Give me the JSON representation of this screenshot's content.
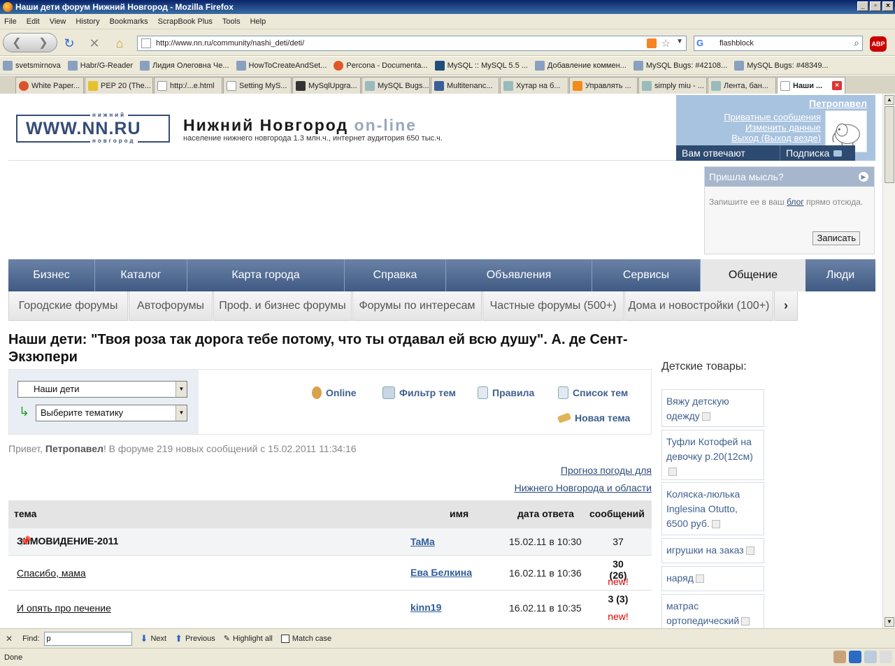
{
  "window": {
    "title": "Наши дети форум Нижний Новгород - Mozilla Firefox",
    "btn_min": "_",
    "btn_max": "▫",
    "btn_close": "×"
  },
  "menu": [
    "File",
    "Edit",
    "View",
    "History",
    "Bookmarks",
    "ScrapBook Plus",
    "Tools",
    "Help"
  ],
  "nav": {
    "url": "http://www.nn.ru/community/nashi_deti/deti/",
    "search_value": "flashblock",
    "abp": "ABP"
  },
  "bookmarks": [
    "svetsmirnova",
    "Habr/G-Reader",
    "Лидия Олеговна Че...",
    "HowToCreateAndSet...",
    "Percona - Documenta...",
    "MySQL :: MySQL 5.5 ...",
    "Добавление коммен...",
    "MySQL Bugs: #42108...",
    "MySQL Bugs: #48349..."
  ],
  "tabs": [
    "White Paper...",
    "PEP 20 (The...",
    "http:/...e.html",
    "Setting MyS...",
    "MySqlUpgra...",
    "MySQL Bugs...",
    "Multitenanc...",
    "Хутар на б...",
    "Управлять ...",
    "simply miu - ...",
    "Лента, бан...",
    "Наши ..."
  ],
  "site": {
    "logo": "WWW.NN.RU",
    "logo_top": "нижний",
    "logo_bottom": "новгород",
    "title": "Нижний Новгород",
    "title_suffix": "on-line",
    "subtitle": "население нижнего новгорода 1.3 млн.ч., интернет аудитория 650 тыс.ч."
  },
  "user": {
    "name": "Петропавел",
    "links": [
      "Приватные сообщения",
      "Изменить данные",
      "Выход (Выход везде)"
    ],
    "bar_left": "Вам отвечают",
    "bar_right": "Подписка"
  },
  "idea": {
    "title": "Пришла мысль?",
    "text_before": "Запишите ее в ваш ",
    "link": "блог",
    "text_after": " прямо отсюда.",
    "button": "Записать"
  },
  "main_nav": [
    {
      "label": "Бизнес"
    },
    {
      "label": "Каталог"
    },
    {
      "label": "Карта города"
    },
    {
      "label": "Справка"
    },
    {
      "label": "Объявления"
    },
    {
      "label": "Сервисы"
    },
    {
      "label": "Общение"
    },
    {
      "label": "Люди"
    }
  ],
  "sub_nav": [
    "Городские форумы",
    "Автофорумы",
    "Проф. и бизнес форумы",
    "Форумы по интересам",
    "Частные форумы (500+)",
    "Дома и новостройки (100+)"
  ],
  "forum": {
    "title": "Наши дети: \"Твоя роза так дорога тебе потому, что ты отдавал ей всю душу\". А. де Сент-Экзюпери",
    "select_forum": "Наши дети",
    "select_theme": "Выберите тематику",
    "tools": [
      "Online",
      "Фильтр тем",
      "Правила",
      "Список тем",
      "Новая тема"
    ],
    "greet_prefix": "Привет, ",
    "greet_user": "Петропавел",
    "greet_suffix": "! В форуме 219 новых сообщений с 15.02.2011 11:34:16",
    "weather_line1": "Прогноз погоды для",
    "weather_line2": "Нижнего Новгорода и области",
    "columns": [
      "тема",
      "имя",
      "дата ответа",
      "сообщений"
    ],
    "rows": [
      {
        "topic": "ЗИМОВИДЕНИЕ-2011",
        "author": "TaMa",
        "date": "15.02.11 в 10:30",
        "count": "37",
        "new": ""
      },
      {
        "topic": "Спасибо, мама",
        "author": "Ева Белкина",
        "date": "16.02.11 в 10:36",
        "count": "30 (26)",
        "new": "new!"
      },
      {
        "topic": "И опять про печение",
        "author": "kinn19",
        "date": "16.02.11 в 10:35",
        "count": "3 (3)",
        "new": "new!"
      }
    ]
  },
  "kids": {
    "title": "Детские товары:",
    "items": [
      "Вяжу детскую одежду",
      "Туфли Котофей на девочку р.20(12см)",
      "Коляска-люлька Inglesina Otutto, 6500 руб.",
      "игрушки на заказ",
      "наряд",
      "матрас ортопедический"
    ]
  },
  "find": {
    "label": "Find:",
    "value": "p",
    "next": "Next",
    "previous": "Previous",
    "highlight": "Highlight all",
    "match": "Match case"
  },
  "status": "Done"
}
